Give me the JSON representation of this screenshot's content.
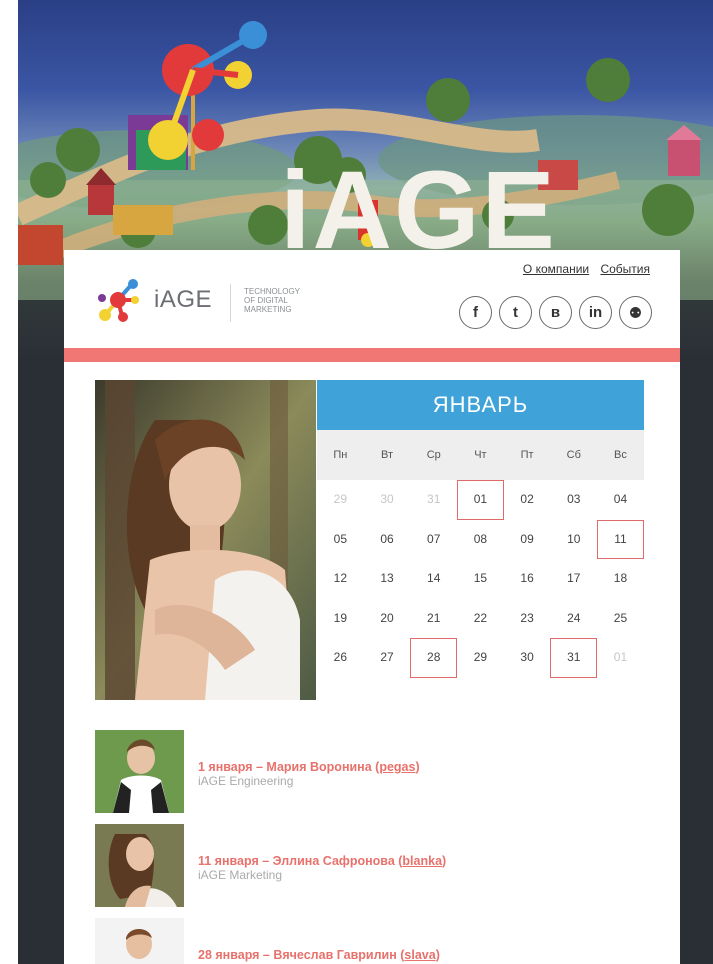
{
  "header": {
    "logo_name": "iAGE",
    "logo_tagline": [
      "TECHNOLOGY",
      "OF DIGITAL",
      "MARKETING"
    ],
    "nav": [
      {
        "label": "О компании"
      },
      {
        "label": "События"
      }
    ],
    "social": [
      {
        "icon": "facebook-icon",
        "glyph": "f"
      },
      {
        "icon": "twitter-icon",
        "glyph": "t"
      },
      {
        "icon": "vkontakte-icon",
        "glyph": "в"
      },
      {
        "icon": "linkedin-icon",
        "glyph": "in"
      },
      {
        "icon": "slideshare-icon",
        "glyph": "⚉"
      }
    ]
  },
  "hero": {
    "sign_text": "iAGE"
  },
  "calendar": {
    "month": "ЯНВАРЬ",
    "weekdays": [
      "Пн",
      "Вт",
      "Ср",
      "Чт",
      "Пт",
      "Сб",
      "Вс"
    ],
    "weeks": [
      [
        "29",
        "30",
        "31",
        "01",
        "02",
        "03",
        "04"
      ],
      [
        "05",
        "06",
        "07",
        "08",
        "09",
        "10",
        "11"
      ],
      [
        "12",
        "13",
        "14",
        "15",
        "16",
        "17",
        "18"
      ],
      [
        "19",
        "20",
        "21",
        "22",
        "23",
        "24",
        "25"
      ],
      [
        "26",
        "27",
        "28",
        "29",
        "30",
        "31",
        "01"
      ]
    ],
    "muted_days": [
      "0-0",
      "0-1",
      "0-2",
      "4-6"
    ],
    "highlighted_days": [
      "0-3",
      "1-6",
      "4-2",
      "4-5"
    ]
  },
  "birthdays": [
    {
      "date_name": "1 января – Мария Воронина (",
      "nick": "pegas",
      "close": ")",
      "dept": "iAGE Engineering"
    },
    {
      "date_name": "11 января – Эллина Сафронова (",
      "nick": "blanka",
      "close": ")",
      "dept": "iAGE Marketing"
    },
    {
      "date_name": "28 января – Вячеслав Гаврилин (",
      "nick": "slava",
      "close": ")",
      "dept": ""
    }
  ],
  "colors": {
    "accent_red": "#f07773",
    "calendar_blue": "#3fa3d9",
    "name_red": "#e8716b"
  }
}
